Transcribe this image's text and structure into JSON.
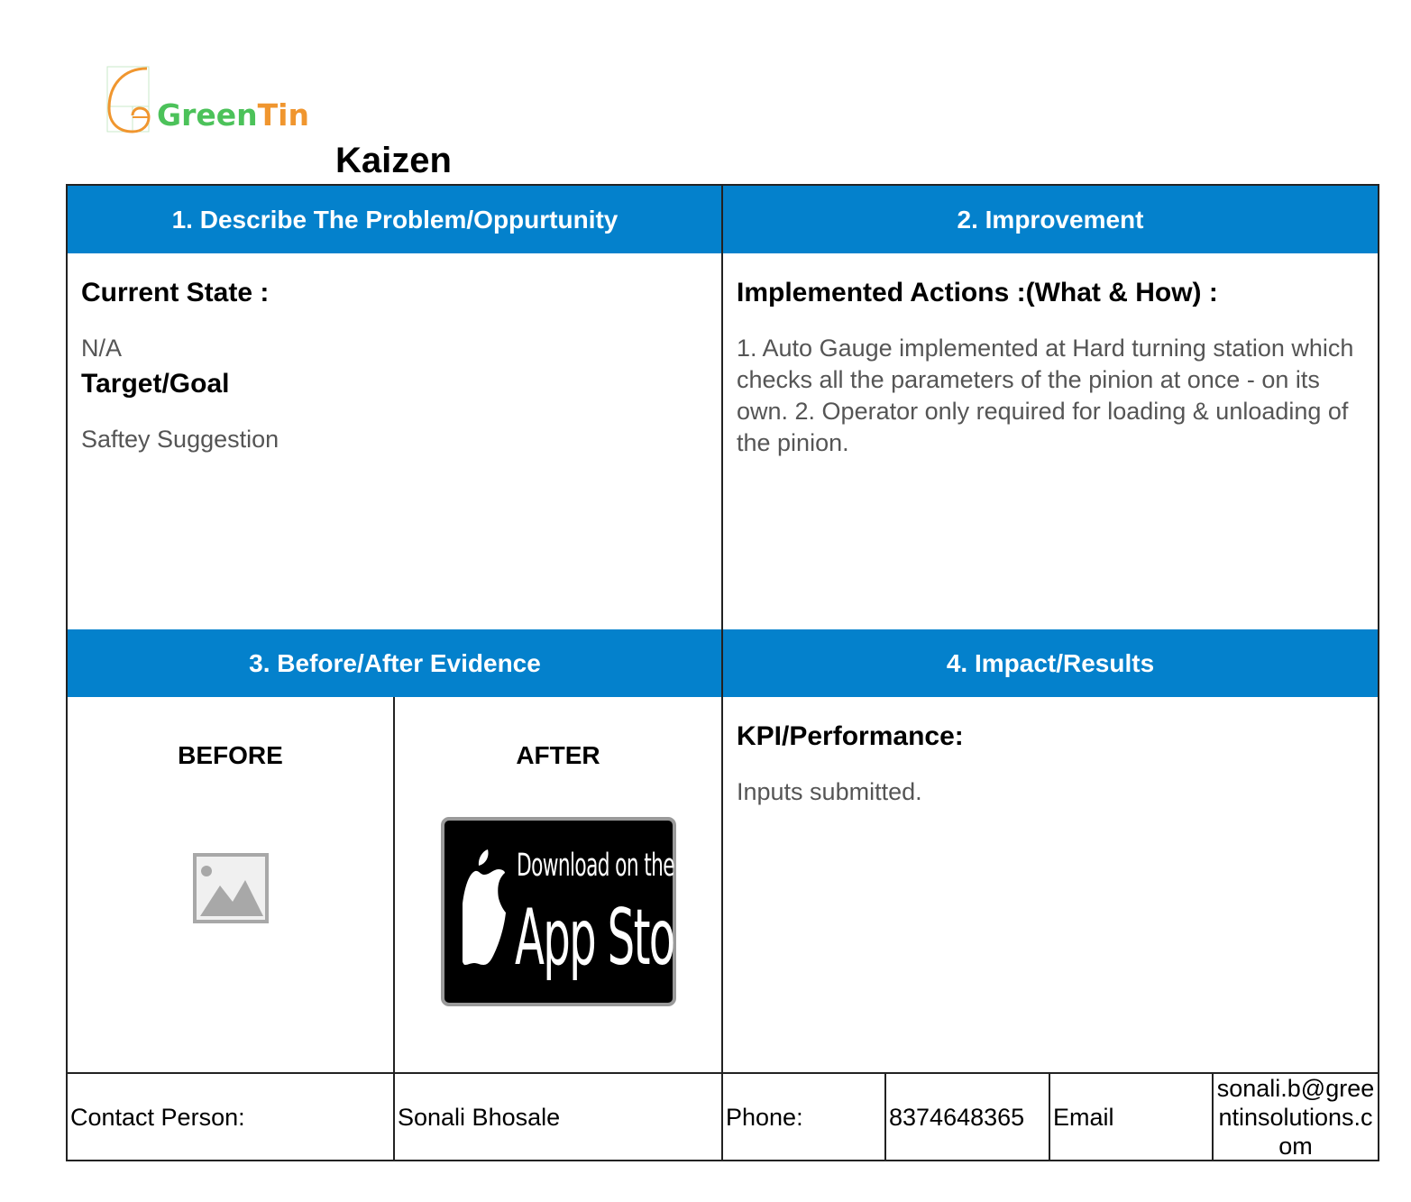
{
  "brand": {
    "logo_text_a": "Green",
    "logo_text_b": "Tin",
    "green": "#4cc25a",
    "orange": "#f0962f"
  },
  "document": {
    "title": "Kaizen",
    "accent": "#0481cc"
  },
  "sections": {
    "problem": {
      "header": "1. Describe The Problem/Oppurtunity",
      "current_state_label": "Current State :",
      "current_state_value": "N/A",
      "target_label": "Target/Goal",
      "target_value": "Saftey Suggestion"
    },
    "improvement": {
      "header": "2. Improvement",
      "actions_label": "Implemented Actions :(What & How) :",
      "actions_value": "1. Auto Gauge implemented at Hard turning station which checks all the parameters of the pinion at once - on its own. 2. Operator only required for loading & unloading of the pinion."
    },
    "evidence": {
      "header": "3. Before/After Evidence",
      "before_label": "BEFORE",
      "before_icon": "image-placeholder-icon",
      "after_label": "AFTER",
      "after_icon": "apple-logo-icon",
      "after_badge_line1": "Download on the",
      "after_badge_line2": "App Store"
    },
    "impact": {
      "header": "4. Impact/Results",
      "kpi_label": "KPI/Performance:",
      "kpi_value": "Inputs submitted."
    }
  },
  "contact": {
    "person_label": "Contact Person:",
    "person_value": "Sonali Bhosale",
    "phone_label": "Phone:",
    "phone_value": "8374648365",
    "email_label": "Email",
    "email_line1": "sonali.b@gree",
    "email_line2": "ntinsolutions.c",
    "email_line3": "om"
  }
}
